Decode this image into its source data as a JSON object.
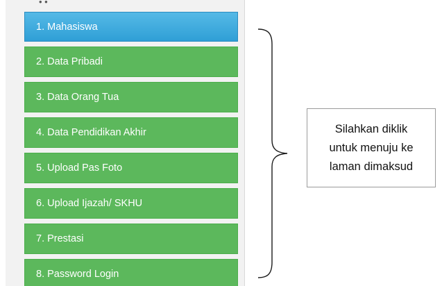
{
  "top_stub_text": "• •",
  "menu": {
    "items": [
      {
        "label": "1. Mahasiswa",
        "active": true
      },
      {
        "label": "2. Data Pribadi"
      },
      {
        "label": "3. Data Orang Tua"
      },
      {
        "label": "4. Data Pendidikan Akhir"
      },
      {
        "label": "5. Upload Pas Foto"
      },
      {
        "label": "6. Upload Ijazah/ SKHU"
      },
      {
        "label": "7. Prestasi"
      },
      {
        "label": "8. Password Login"
      }
    ]
  },
  "callout": {
    "lines": [
      "Silahkan diklik",
      "untuk menuju ke",
      "laman dimaksud"
    ]
  },
  "colors": {
    "active_item": "#2f9fd6",
    "menu_item": "#5cb85c",
    "panel_background": "#f2f2f2"
  }
}
